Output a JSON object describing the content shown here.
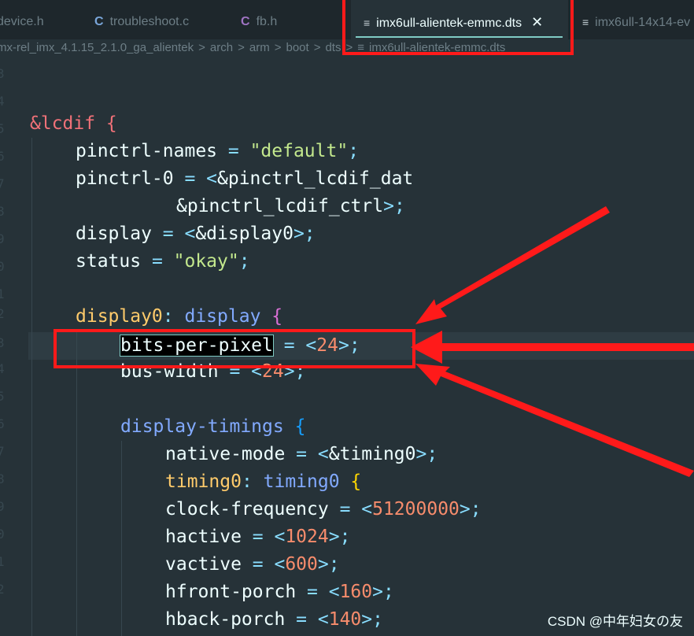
{
  "tabs": [
    {
      "label": "device.h",
      "icon": "none"
    },
    {
      "label": "troubleshoot.c",
      "icon": "c-file-icon"
    },
    {
      "label": "fb.h",
      "icon": "c-file-icon"
    },
    {
      "label": "imx6ull-alientek-emmc.dts",
      "icon": "lines-file-icon",
      "active": true
    },
    {
      "label": "imx6ull-14x14-ev",
      "icon": "lines-file-icon"
    }
  ],
  "close_glyph": "✕",
  "breadcrumb": [
    "mx-rel_imx_4.1.15_2.1.0_ga_alientek",
    "arch",
    "arm",
    "boot",
    "dts",
    "imx6ull-alientek-emmc.dts"
  ],
  "breadcrumb_sep": ">",
  "code": {
    "l1": "&lcdif {",
    "l2_prop": "pinctrl-names",
    "l2_val": "\"default\"",
    "l3_prop": "pinctrl-0",
    "l3_val": "&pinctrl_lcdif_dat",
    "l4_val": "&pinctrl_lcdif_ctrl",
    "l5_prop": "display",
    "l5_val": "&display0",
    "l6_prop": "status",
    "l6_val": "\"okay\"",
    "l8_label": "display0",
    "l8_node": "display",
    "l9_prop": "bits-per-pixel",
    "l9_val": "24",
    "l10_prop": "bus-width",
    "l10_val": "24",
    "l12_node": "display-timings",
    "l13_prop": "native-mode",
    "l13_val": "&timing0",
    "l14_label": "timing0",
    "l14_node": "timing0",
    "l15_prop": "clock-frequency",
    "l15_val": "51200000",
    "l16_prop": "hactive",
    "l16_val": "1024",
    "l17_prop": "vactive",
    "l17_val": "600",
    "l18_prop": "hfront-porch",
    "l18_val": "160",
    "l19_prop": "hback-porch",
    "l19_val": "140"
  },
  "gutter_digits": [
    "3",
    "4",
    "5",
    "6",
    "7",
    "8",
    "9",
    "0",
    "1",
    "2",
    "3",
    "4",
    "5",
    "6",
    "7",
    "8",
    "9",
    "0",
    "1",
    "2"
  ],
  "watermark": "CSDN @中年妇女の友",
  "colors": {
    "annotation": "#ff1a1a",
    "accent": "#80cbc4"
  }
}
